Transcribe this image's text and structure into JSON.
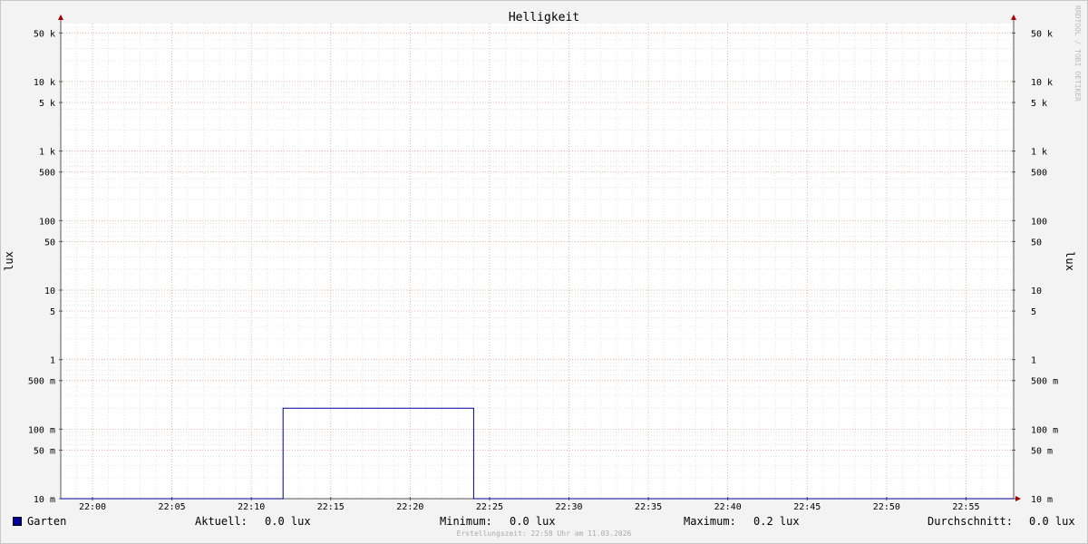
{
  "chart_data": {
    "type": "line",
    "title": "Helligkeit",
    "ylabel": "lux",
    "ylabel_right": "lux",
    "y_scale": "log",
    "ylim": [
      0.01,
      70000
    ],
    "y_ticks": [
      {
        "v": 50000,
        "label": "50 k"
      },
      {
        "v": 10000,
        "label": "10 k"
      },
      {
        "v": 5000,
        "label": "5 k"
      },
      {
        "v": 1000,
        "label": "1 k"
      },
      {
        "v": 500,
        "label": "500"
      },
      {
        "v": 100,
        "label": "100"
      },
      {
        "v": 50,
        "label": "50"
      },
      {
        "v": 10,
        "label": "10"
      },
      {
        "v": 5,
        "label": "5"
      },
      {
        "v": 1,
        "label": "1"
      },
      {
        "v": 0.5,
        "label": "500 m"
      },
      {
        "v": 0.1,
        "label": "100 m"
      },
      {
        "v": 0.05,
        "label": "50 m"
      },
      {
        "v": 0.01,
        "label": "10 m"
      }
    ],
    "xlim": [
      "21:58",
      "22:58"
    ],
    "x_ticks": [
      "22:00",
      "22:05",
      "22:10",
      "22:15",
      "22:20",
      "22:25",
      "22:30",
      "22:35",
      "22:40",
      "22:45",
      "22:50",
      "22:55"
    ],
    "grid": true,
    "series": [
      {
        "name": "Garten",
        "color": "#0000a0",
        "points": [
          [
            "21:58",
            0.01
          ],
          [
            "22:12",
            0.01
          ],
          [
            "22:12",
            0.2
          ],
          [
            "22:24",
            0.2
          ],
          [
            "22:24",
            0.01
          ],
          [
            "22:58",
            0.01
          ]
        ]
      }
    ]
  },
  "legend": {
    "series_name": "Garten",
    "color": "#0000a0",
    "stats": [
      {
        "label": "Aktuell:",
        "value": "0.0 lux"
      },
      {
        "label": "Minimum:",
        "value": "0.0 lux"
      },
      {
        "label": "Maximum:",
        "value": "0.2 lux"
      },
      {
        "label": "Durchschnitt:",
        "value": "0.0 lux"
      }
    ]
  },
  "footer": "Erstellungszeit: 22:58 Uhr am 11.03.2026",
  "watermark": "RRDTOOL / TOBI OETIKER"
}
